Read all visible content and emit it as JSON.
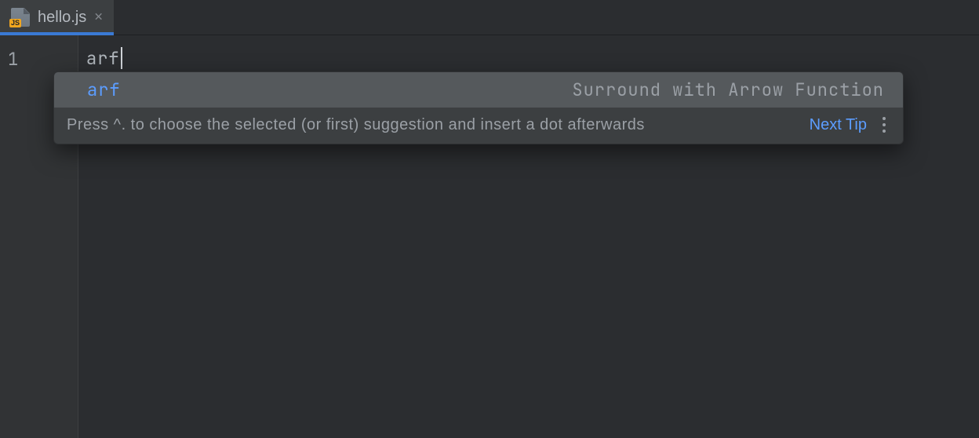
{
  "tab": {
    "filename": "hello.js",
    "icon_badge": "JS"
  },
  "editor": {
    "line_number": "1",
    "code": "arf"
  },
  "popup": {
    "item": {
      "label": "arf",
      "description": "Surround with Arrow Function"
    },
    "footer": {
      "hint": "Press ^. to choose the selected (or first) suggestion and insert a dot afterwards",
      "link": "Next Tip"
    }
  }
}
